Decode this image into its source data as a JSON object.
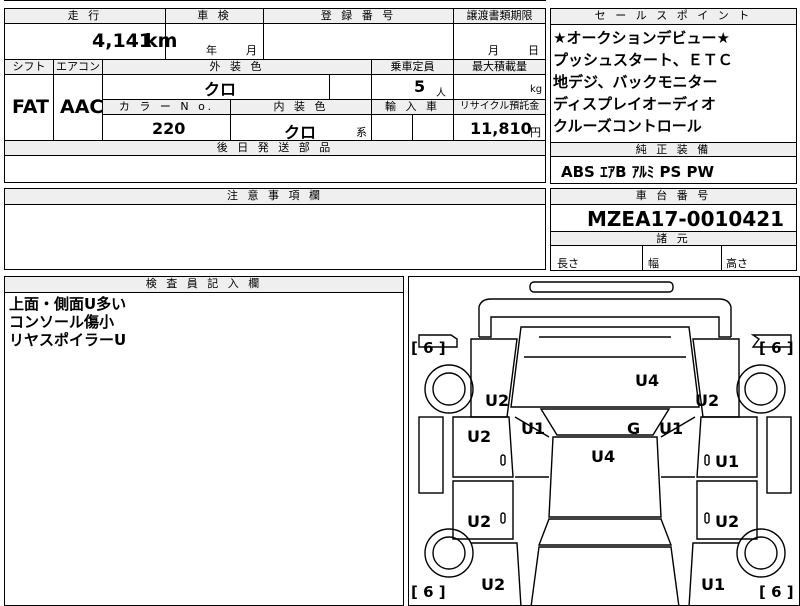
{
  "top": {
    "mileage_header": "走 行",
    "mileage_value": "4,141",
    "mileage_unit": "km",
    "inspection_header": "車 検",
    "inspection_year": "年",
    "inspection_month": "月",
    "registration_header": "登 録 番 号",
    "transfer_header": "譲渡書類期限",
    "transfer_month": "月",
    "transfer_day": "日",
    "shift_header": "シフト",
    "aircon_header": "エアコン",
    "exterior_color_header": "外 装 色",
    "capacity_header": "乗車定員",
    "max_load_header": "最大積載量",
    "shift_value": "FAT",
    "aircon_value": "AAC",
    "exterior_color_value": "クロ",
    "capacity_value": "5",
    "capacity_unit": "人",
    "max_load_unit": "kg",
    "color_no_header": "カ ラ ー N o.",
    "interior_color_header": "内 装 色",
    "import_header": "輸 入 車",
    "recycle_header": "リサイクル預託金",
    "color_no_value": "220",
    "interior_color_value": "クロ",
    "interior_color_suffix": "系",
    "recycle_value": "11,810",
    "recycle_unit": "円",
    "parts_header": "後 日 発 送 部 品"
  },
  "sales": {
    "header": "セ ー ル ス ポ イ ン ト",
    "lines": [
      "★オークションデビュー★",
      "プッシュスタート、ＥＴＣ",
      "地デジ、バックモニター",
      "ディスプレイオーディオ",
      "クルーズコントロール"
    ],
    "equipment_header": "純 正 装 備",
    "equipment_value": "ABS ｴｱB ｱﾙﾐ PS PW"
  },
  "notes": {
    "header": "注 意 事 項 欄"
  },
  "chassis": {
    "header": "車 台 番 号",
    "value": "MZEA17-0010421",
    "dims_header": "諸 元",
    "length_label": "長さ",
    "width_label": "幅",
    "height_label": "高さ"
  },
  "inspector": {
    "header": "検 査 員 記 入 欄",
    "lines": [
      "上面・側面U多い",
      "コンソール傷小",
      "リヤスポイラーU"
    ]
  },
  "diagram": {
    "tire_tl": "6",
    "tire_tr": "6",
    "tire_bl": "6",
    "tire_br": "6",
    "marks": {
      "roof_front": "U4",
      "hood_l": "U2",
      "hood_r": "U2",
      "pillar_l": "U1",
      "pillar_r": "U1",
      "glass": "G",
      "roof": "U4",
      "front_door_l": "U2",
      "front_door_r": "U1",
      "rear_door_l": "U2",
      "rear_door_r": "U2",
      "rear_l": "U2",
      "rear_r": "U1"
    }
  }
}
